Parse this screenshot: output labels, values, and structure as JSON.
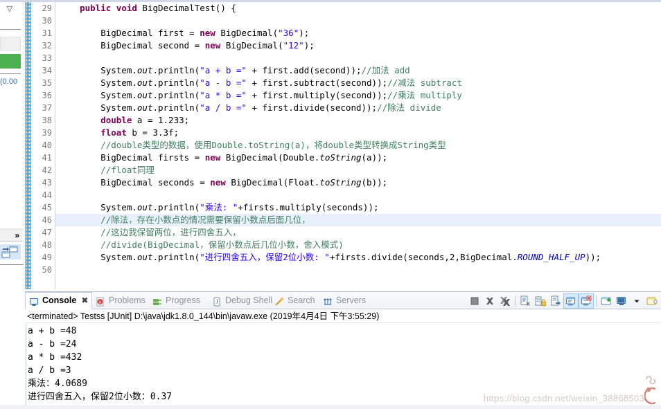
{
  "editor": {
    "first_line_number": 29,
    "highlighted_line": 46,
    "lines": [
      {
        "n": 29,
        "tokens": [
          {
            "t": "    ",
            "c": "pln"
          },
          {
            "t": "public",
            "c": "kw"
          },
          {
            "t": " ",
            "c": "pln"
          },
          {
            "t": "void",
            "c": "kw"
          },
          {
            "t": " BigDecimalTest() {",
            "c": "pln"
          }
        ]
      },
      {
        "n": 30,
        "tokens": []
      },
      {
        "n": 31,
        "tokens": [
          {
            "t": "        BigDecimal ",
            "c": "pln"
          },
          {
            "t": "first",
            "c": "pln"
          },
          {
            "t": " = ",
            "c": "pln"
          },
          {
            "t": "new",
            "c": "kw"
          },
          {
            "t": " BigDecimal(",
            "c": "pln"
          },
          {
            "t": "\"36\"",
            "c": "str"
          },
          {
            "t": ");",
            "c": "pln"
          }
        ]
      },
      {
        "n": 32,
        "tokens": [
          {
            "t": "        BigDecimal second = ",
            "c": "pln"
          },
          {
            "t": "new",
            "c": "kw"
          },
          {
            "t": " BigDecimal(",
            "c": "pln"
          },
          {
            "t": "\"12\"",
            "c": "str"
          },
          {
            "t": ");",
            "c": "pln"
          }
        ]
      },
      {
        "n": 33,
        "tokens": []
      },
      {
        "n": 34,
        "tokens": [
          {
            "t": "        System.",
            "c": "pln"
          },
          {
            "t": "out",
            "c": "stc"
          },
          {
            "t": ".println(",
            "c": "pln"
          },
          {
            "t": "\"a + b =\"",
            "c": "str"
          },
          {
            "t": " + first.add(second));",
            "c": "pln"
          },
          {
            "t": "//加法 add",
            "c": "cmt"
          }
        ]
      },
      {
        "n": 35,
        "tokens": [
          {
            "t": "        System.",
            "c": "pln"
          },
          {
            "t": "out",
            "c": "stc"
          },
          {
            "t": ".println(",
            "c": "pln"
          },
          {
            "t": "\"a - b =\"",
            "c": "str"
          },
          {
            "t": " + first.subtract(second));",
            "c": "pln"
          },
          {
            "t": "//减法 subtract",
            "c": "cmt"
          }
        ]
      },
      {
        "n": 36,
        "tokens": [
          {
            "t": "        System.",
            "c": "pln"
          },
          {
            "t": "out",
            "c": "stc"
          },
          {
            "t": ".println(",
            "c": "pln"
          },
          {
            "t": "\"a * b =\"",
            "c": "str"
          },
          {
            "t": " + first.multiply(second));",
            "c": "pln"
          },
          {
            "t": "//乘法 multiply",
            "c": "cmt"
          }
        ]
      },
      {
        "n": 37,
        "tokens": [
          {
            "t": "        System.",
            "c": "pln"
          },
          {
            "t": "out",
            "c": "stc"
          },
          {
            "t": ".println(",
            "c": "pln"
          },
          {
            "t": "\"a / b =\"",
            "c": "str"
          },
          {
            "t": " + first.divide(second));",
            "c": "pln"
          },
          {
            "t": "//除法 divide",
            "c": "cmt"
          }
        ]
      },
      {
        "n": 38,
        "tokens": [
          {
            "t": "        ",
            "c": "pln"
          },
          {
            "t": "double",
            "c": "kw"
          },
          {
            "t": " a = 1.233;",
            "c": "pln"
          }
        ]
      },
      {
        "n": 39,
        "tokens": [
          {
            "t": "        ",
            "c": "pln"
          },
          {
            "t": "float",
            "c": "kw"
          },
          {
            "t": " b = 3.3f;",
            "c": "pln"
          }
        ]
      },
      {
        "n": 40,
        "tokens": [
          {
            "t": "        ",
            "c": "pln"
          },
          {
            "t": "//double类型的数据，使用Double.toString(a)，将double类型转换成String类型",
            "c": "cmt"
          }
        ]
      },
      {
        "n": 41,
        "tokens": [
          {
            "t": "        BigDecimal firsts = ",
            "c": "pln"
          },
          {
            "t": "new",
            "c": "kw"
          },
          {
            "t": " BigDecimal(Double.",
            "c": "pln"
          },
          {
            "t": "toString",
            "c": "stc"
          },
          {
            "t": "(a));",
            "c": "pln"
          }
        ]
      },
      {
        "n": 42,
        "tokens": [
          {
            "t": "        ",
            "c": "pln"
          },
          {
            "t": "//float同理",
            "c": "cmt"
          }
        ]
      },
      {
        "n": 43,
        "tokens": [
          {
            "t": "        BigDecimal seconds = ",
            "c": "pln"
          },
          {
            "t": "new",
            "c": "kw"
          },
          {
            "t": " BigDecimal(Float.",
            "c": "pln"
          },
          {
            "t": "toString",
            "c": "stc"
          },
          {
            "t": "(b));",
            "c": "pln"
          }
        ]
      },
      {
        "n": 44,
        "tokens": []
      },
      {
        "n": 45,
        "tokens": [
          {
            "t": "        System.",
            "c": "pln"
          },
          {
            "t": "out",
            "c": "stc"
          },
          {
            "t": ".println(",
            "c": "pln"
          },
          {
            "t": "\"乘法: \"",
            "c": "str"
          },
          {
            "t": "+firsts.multiply(seconds));",
            "c": "pln"
          }
        ]
      },
      {
        "n": 46,
        "tokens": [
          {
            "t": "        ",
            "c": "pln"
          },
          {
            "t": "//除法，存在小数点的情况需要保留小数点后面几位，",
            "c": "cmt"
          }
        ]
      },
      {
        "n": 47,
        "tokens": [
          {
            "t": "        ",
            "c": "pln"
          },
          {
            "t": "//这边我保留两位，进行四舍五入，",
            "c": "cmt"
          }
        ]
      },
      {
        "n": 48,
        "tokens": [
          {
            "t": "        ",
            "c": "pln"
          },
          {
            "t": "//divide(BigDecimal，保留小数点后几位小数，舍入模式)",
            "c": "cmt"
          }
        ]
      },
      {
        "n": 49,
        "tokens": [
          {
            "t": "        System.",
            "c": "pln"
          },
          {
            "t": "out",
            "c": "stc"
          },
          {
            "t": ".println(",
            "c": "pln"
          },
          {
            "t": "\"进行四舍五入，保留2位小数: \"",
            "c": "str"
          },
          {
            "t": "+firsts.divide(seconds,2,BigDecimal.",
            "c": "pln"
          },
          {
            "t": "ROUND_HALF_UP",
            "c": "cnst"
          },
          {
            "t": "));",
            "c": "pln"
          }
        ]
      },
      {
        "n": 50,
        "tokens": []
      }
    ]
  },
  "junit_panel": {
    "timing_label": "(0.00",
    "chevron_icon": "collapse-chevron-icon",
    "green_bar_color": "#4caf50",
    "expand_arrow": "»"
  },
  "console": {
    "tabs": [
      {
        "label": "Console",
        "icon": "console-icon",
        "active": true,
        "close": "✖"
      },
      {
        "label": "Problems",
        "icon": "problems-icon",
        "active": false
      },
      {
        "label": "Progress",
        "icon": "progress-icon",
        "active": false
      },
      {
        "label": "Debug Shell",
        "icon": "debug-shell-icon",
        "active": false
      },
      {
        "label": "Search",
        "icon": "search-icon",
        "active": false
      },
      {
        "label": "Servers",
        "icon": "servers-icon",
        "active": false
      }
    ],
    "toolbar": [
      {
        "name": "terminate-button",
        "label": "Terminate"
      },
      {
        "name": "remove-launch-button",
        "label": "Remove Launch"
      },
      {
        "name": "remove-all-terminated-button",
        "label": "Remove All Terminated Launches"
      },
      {
        "name": "clear-console-button",
        "label": "Clear Console"
      },
      {
        "name": "scroll-lock-button",
        "label": "Scroll Lock"
      },
      {
        "name": "word-wrap-button",
        "label": "Word Wrap"
      },
      {
        "name": "show-console-button",
        "label": "Display Selected Console"
      },
      {
        "name": "pin-console-button",
        "label": "Pin Console"
      },
      {
        "name": "open-console-button",
        "label": "Open Console"
      },
      {
        "name": "display-selected-console-button",
        "label": "Display Selected Console"
      },
      {
        "name": "console-menu-button",
        "label": "Menu"
      },
      {
        "name": "new-console-view-button",
        "label": "New Console View"
      }
    ],
    "status_line": "<terminated> Testss [JUnit] D:\\java\\jdk1.8.0_144\\bin\\javaw.exe (2019年4月4日 下午3:55:29)",
    "output_lines": [
      "a + b =48",
      "a - b =24",
      "a * b =432",
      "a / b =3",
      "乘法：4.0689",
      "进行四舍五入，保留2位小数：0.37"
    ],
    "watermark": "https://blog.csdn.net/weixin_38868503"
  },
  "colors": {
    "keyword": "#7f0055",
    "string": "#2a00ff",
    "comment": "#3f7f5f",
    "field": "#0000c0",
    "highlight_row": "#e8f0fb",
    "change_bar": "#1e9ad6",
    "tab_active_text": "#000000",
    "tab_inactive_text": "#8a9199"
  }
}
